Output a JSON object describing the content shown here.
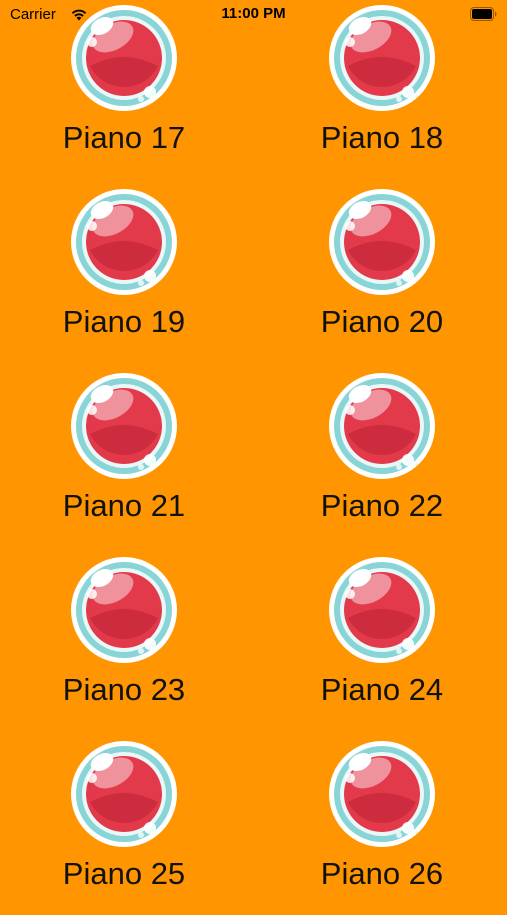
{
  "status_bar": {
    "carrier": "Carrier",
    "time": "11:00 PM"
  },
  "colors": {
    "background": "#FF9500",
    "bubble_ring": "#88D4D6",
    "bubble_red": "#E23A4B",
    "bubble_red_dark": "#C6283A",
    "bubble_outline": "#FFFFFF"
  },
  "items": [
    {
      "label": "Piano 17",
      "icon": "red-bubble-icon"
    },
    {
      "label": "Piano 18",
      "icon": "red-bubble-icon"
    },
    {
      "label": "Piano 19",
      "icon": "red-bubble-icon"
    },
    {
      "label": "Piano 20",
      "icon": "red-bubble-icon"
    },
    {
      "label": "Piano 21",
      "icon": "red-bubble-icon"
    },
    {
      "label": "Piano 22",
      "icon": "red-bubble-icon"
    },
    {
      "label": "Piano 23",
      "icon": "red-bubble-icon"
    },
    {
      "label": "Piano 24",
      "icon": "red-bubble-icon"
    },
    {
      "label": "Piano 25",
      "icon": "red-bubble-icon"
    },
    {
      "label": "Piano 26",
      "icon": "red-bubble-icon"
    }
  ]
}
